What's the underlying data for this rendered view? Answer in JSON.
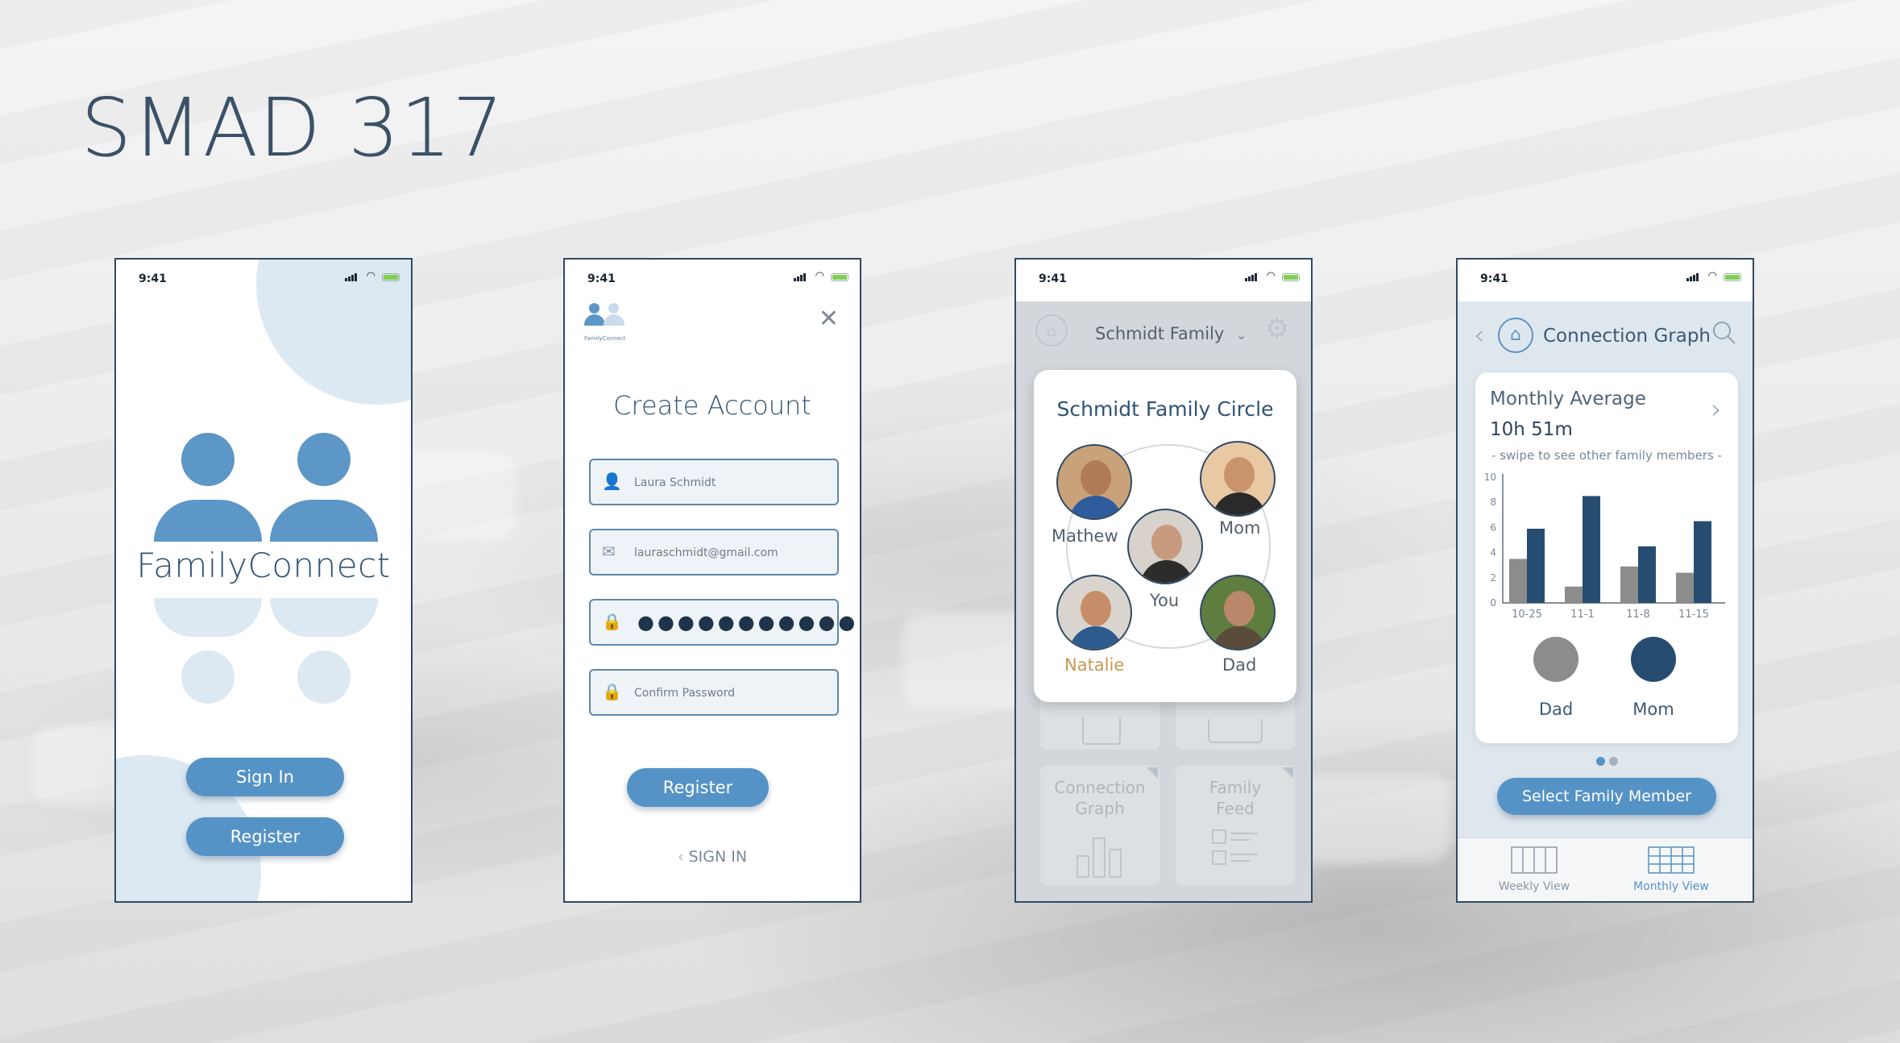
{
  "slide": {
    "title": "SMAD 317"
  },
  "status": {
    "time": "9:41"
  },
  "screen1": {
    "brand": "FamilyConnect",
    "sign_in_label": "Sign In",
    "register_label": "Register"
  },
  "screen2": {
    "logo_text": "FamilyConnect",
    "close_icon": "close-icon",
    "heading": "Create Account",
    "name_value": "Laura Schmidt",
    "email_value": "lauraschmidt@gmail.com",
    "password_mask": "●●●●●●●●●●●",
    "confirm_placeholder": "Confirm Password",
    "register_label": "Register",
    "signin_link": "SIGN IN"
  },
  "screen3": {
    "family_selector": "Schmidt Family",
    "card_title": "Schmidt Family Circle",
    "members": {
      "mathew": "Mathew",
      "mom": "Mom",
      "you": "You",
      "natalie": "Natalie",
      "dad": "Dad"
    },
    "tile_connection_line1": "Connection",
    "tile_connection_line2": "Graph",
    "tile_feed_line1": "Family",
    "tile_feed_line2": "Feed"
  },
  "screen4": {
    "title": "Connection Graph",
    "card_title": "Monthly Average",
    "card_value": "10h 51m",
    "swipe_hint": "- swipe to see other family members -",
    "legend_dad": "Dad",
    "legend_mom": "Mom",
    "select_button": "Select Family Member",
    "tab_weekly": "Weekly View",
    "tab_monthly": "Monthly View"
  },
  "colors": {
    "accent": "#5593c6",
    "dad_series": "#8c8c8c",
    "mom_series": "#264d70",
    "light_blue": "#dde9f2"
  },
  "chart_data": {
    "type": "bar",
    "categories": [
      "10-25",
      "11-1",
      "11-8",
      "11-15"
    ],
    "series": [
      {
        "name": "Dad",
        "values": [
          3.5,
          1.3,
          2.9,
          2.4
        ]
      },
      {
        "name": "Mom",
        "values": [
          5.9,
          8.5,
          4.5,
          6.5
        ]
      }
    ],
    "y_ticks": [
      "0",
      "2",
      "4",
      "6",
      "8",
      "10"
    ],
    "ylim": [
      0,
      10
    ],
    "grid": false,
    "legend": "bottom"
  }
}
